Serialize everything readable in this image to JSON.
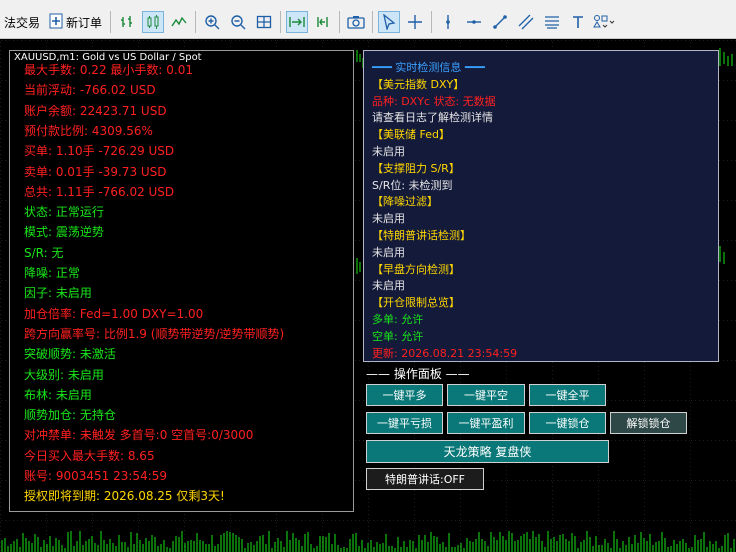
{
  "toolbar": {
    "algo_trading": "法交易",
    "new_order": "新订单"
  },
  "window_title": "XAUUSD,m1:  Gold vs US Dollar / Spot",
  "left_panel": {
    "lines": [
      {
        "text": "最大手数: 0.22   最小手数: 0.01",
        "color": "#ff2020"
      },
      {
        "text": "当前浮动: -766.02 USD",
        "color": "#ff2020"
      },
      {
        "text": "账户余额: 22423.71 USD",
        "color": "#ff2020"
      },
      {
        "text": "预付款比例: 4309.56%",
        "color": "#ff2020"
      },
      {
        "text": "买单: 1.10手   -726.29 USD",
        "color": "#ff2020"
      },
      {
        "text": "卖单: 0.01手   -39.73 USD",
        "color": "#ff2020"
      },
      {
        "text": "总共: 1.11手   -766.02 USD",
        "color": "#ff2020"
      },
      {
        "text": "状态: 正常运行",
        "color": "#19e619"
      },
      {
        "text": "模式: 震荡逆势",
        "color": "#19e619"
      },
      {
        "text": "S/R: 无",
        "color": "#19e619"
      },
      {
        "text": "降噪: 正常",
        "color": "#19e619"
      },
      {
        "text": "因子: 未启用",
        "color": "#19e619"
      },
      {
        "text": "加仓倍率: Fed=1.00 DXY=1.00",
        "color": "#ff2020"
      },
      {
        "text": "跨方向赢率号: 比例1.9 (顺势带逆势/逆势带顺势)",
        "color": "#ff2020"
      },
      {
        "text": "突破顺势: 未激活",
        "color": "#19e619"
      },
      {
        "text": "大级别: 未启用",
        "color": "#19e619"
      },
      {
        "text": "布林: 未启用",
        "color": "#19e619"
      },
      {
        "text": "顺势加仓: 无持仓",
        "color": "#19e619"
      },
      {
        "text": "对冲禁单: 未触发  多首号:0 空首号:0/3000",
        "color": "#ff2020"
      },
      {
        "text": "今日买入最大手数: 8.65",
        "color": "#ff2020"
      },
      {
        "text": "账号: 9003451    23:54:59",
        "color": "#ff2020"
      },
      {
        "text": "授权即将到期: 2026.08.25 仅剩3天!",
        "color": "#ffd700"
      }
    ]
  },
  "right_panel": {
    "lines": [
      {
        "text": "━━━ 实时检测信息 ━━━",
        "color": "#3aa0ff"
      },
      {
        "text": "【美元指数 DXY】",
        "color": "#ffd700"
      },
      {
        "text": "品种: DXYc  状态: 无数据",
        "color": "#ff2020"
      },
      {
        "text": "请查看日志了解检测详情",
        "color": "#e6e6e6"
      },
      {
        "text": "【美联储 Fed】",
        "color": "#ffd700"
      },
      {
        "text": "未启用",
        "color": "#e6e6e6"
      },
      {
        "text": "【支撑阻力 S/R】",
        "color": "#ffd700"
      },
      {
        "text": "S/R位: 未检测到",
        "color": "#e6e6e6"
      },
      {
        "text": "【降噪过滤】",
        "color": "#ffd700"
      },
      {
        "text": "未启用",
        "color": "#e6e6e6"
      },
      {
        "text": "【特朗普讲话检测】",
        "color": "#ffd700"
      },
      {
        "text": "未启用",
        "color": "#e6e6e6"
      },
      {
        "text": "【早盘方向检测】",
        "color": "#ffd700"
      },
      {
        "text": "未启用",
        "color": "#e6e6e6"
      },
      {
        "text": "【开仓限制总览】",
        "color": "#ffd700"
      },
      {
        "text": "多单: 允许",
        "color": "#19e619"
      },
      {
        "text": "空单: 允许",
        "color": "#19e619"
      },
      {
        "text": "更新: 2026.08.21 23:54:59",
        "color": "#ff2020"
      }
    ]
  },
  "ops": {
    "title": "—— 操作面板 ——",
    "buy_all": "一键平多",
    "sell_all": "一键平空",
    "close_all": "一键全平",
    "close_loss": "一键平亏损",
    "close_profit": "一键平盈利",
    "lock": "一键锁仓",
    "unlock": "解锁锁仓",
    "strategy": "天龙策略 复盘侠",
    "trump_toggle": "特朗普讲话:OFF"
  }
}
